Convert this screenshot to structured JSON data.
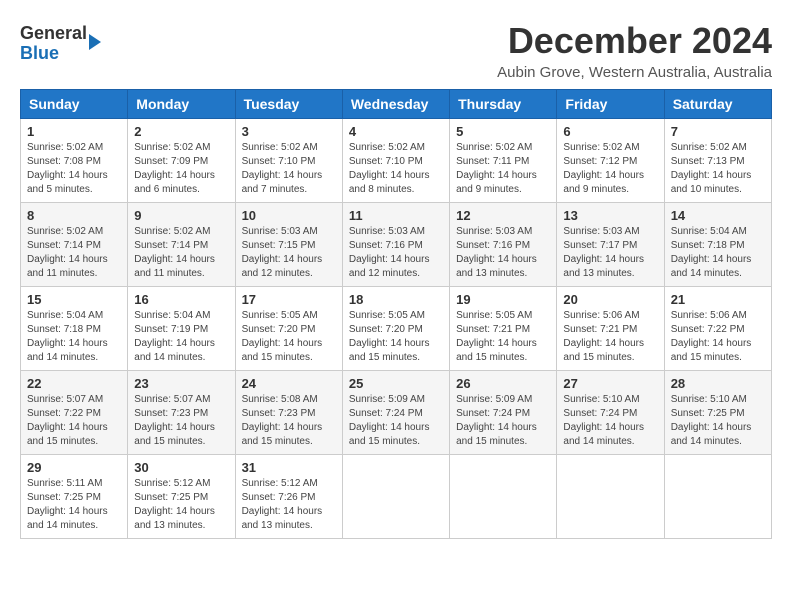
{
  "header": {
    "logo_general": "General",
    "logo_blue": "Blue",
    "title": "December 2024",
    "location": "Aubin Grove, Western Australia, Australia"
  },
  "calendar": {
    "days_of_week": [
      "Sunday",
      "Monday",
      "Tuesday",
      "Wednesday",
      "Thursday",
      "Friday",
      "Saturday"
    ],
    "weeks": [
      [
        {
          "day": "1",
          "info": "Sunrise: 5:02 AM\nSunset: 7:08 PM\nDaylight: 14 hours\nand 5 minutes."
        },
        {
          "day": "2",
          "info": "Sunrise: 5:02 AM\nSunset: 7:09 PM\nDaylight: 14 hours\nand 6 minutes."
        },
        {
          "day": "3",
          "info": "Sunrise: 5:02 AM\nSunset: 7:10 PM\nDaylight: 14 hours\nand 7 minutes."
        },
        {
          "day": "4",
          "info": "Sunrise: 5:02 AM\nSunset: 7:10 PM\nDaylight: 14 hours\nand 8 minutes."
        },
        {
          "day": "5",
          "info": "Sunrise: 5:02 AM\nSunset: 7:11 PM\nDaylight: 14 hours\nand 9 minutes."
        },
        {
          "day": "6",
          "info": "Sunrise: 5:02 AM\nSunset: 7:12 PM\nDaylight: 14 hours\nand 9 minutes."
        },
        {
          "day": "7",
          "info": "Sunrise: 5:02 AM\nSunset: 7:13 PM\nDaylight: 14 hours\nand 10 minutes."
        }
      ],
      [
        {
          "day": "8",
          "info": "Sunrise: 5:02 AM\nSunset: 7:14 PM\nDaylight: 14 hours\nand 11 minutes."
        },
        {
          "day": "9",
          "info": "Sunrise: 5:02 AM\nSunset: 7:14 PM\nDaylight: 14 hours\nand 11 minutes."
        },
        {
          "day": "10",
          "info": "Sunrise: 5:03 AM\nSunset: 7:15 PM\nDaylight: 14 hours\nand 12 minutes."
        },
        {
          "day": "11",
          "info": "Sunrise: 5:03 AM\nSunset: 7:16 PM\nDaylight: 14 hours\nand 12 minutes."
        },
        {
          "day": "12",
          "info": "Sunrise: 5:03 AM\nSunset: 7:16 PM\nDaylight: 14 hours\nand 13 minutes."
        },
        {
          "day": "13",
          "info": "Sunrise: 5:03 AM\nSunset: 7:17 PM\nDaylight: 14 hours\nand 13 minutes."
        },
        {
          "day": "14",
          "info": "Sunrise: 5:04 AM\nSunset: 7:18 PM\nDaylight: 14 hours\nand 14 minutes."
        }
      ],
      [
        {
          "day": "15",
          "info": "Sunrise: 5:04 AM\nSunset: 7:18 PM\nDaylight: 14 hours\nand 14 minutes."
        },
        {
          "day": "16",
          "info": "Sunrise: 5:04 AM\nSunset: 7:19 PM\nDaylight: 14 hours\nand 14 minutes."
        },
        {
          "day": "17",
          "info": "Sunrise: 5:05 AM\nSunset: 7:20 PM\nDaylight: 14 hours\nand 15 minutes."
        },
        {
          "day": "18",
          "info": "Sunrise: 5:05 AM\nSunset: 7:20 PM\nDaylight: 14 hours\nand 15 minutes."
        },
        {
          "day": "19",
          "info": "Sunrise: 5:05 AM\nSunset: 7:21 PM\nDaylight: 14 hours\nand 15 minutes."
        },
        {
          "day": "20",
          "info": "Sunrise: 5:06 AM\nSunset: 7:21 PM\nDaylight: 14 hours\nand 15 minutes."
        },
        {
          "day": "21",
          "info": "Sunrise: 5:06 AM\nSunset: 7:22 PM\nDaylight: 14 hours\nand 15 minutes."
        }
      ],
      [
        {
          "day": "22",
          "info": "Sunrise: 5:07 AM\nSunset: 7:22 PM\nDaylight: 14 hours\nand 15 minutes."
        },
        {
          "day": "23",
          "info": "Sunrise: 5:07 AM\nSunset: 7:23 PM\nDaylight: 14 hours\nand 15 minutes."
        },
        {
          "day": "24",
          "info": "Sunrise: 5:08 AM\nSunset: 7:23 PM\nDaylight: 14 hours\nand 15 minutes."
        },
        {
          "day": "25",
          "info": "Sunrise: 5:09 AM\nSunset: 7:24 PM\nDaylight: 14 hours\nand 15 minutes."
        },
        {
          "day": "26",
          "info": "Sunrise: 5:09 AM\nSunset: 7:24 PM\nDaylight: 14 hours\nand 15 minutes."
        },
        {
          "day": "27",
          "info": "Sunrise: 5:10 AM\nSunset: 7:24 PM\nDaylight: 14 hours\nand 14 minutes."
        },
        {
          "day": "28",
          "info": "Sunrise: 5:10 AM\nSunset: 7:25 PM\nDaylight: 14 hours\nand 14 minutes."
        }
      ],
      [
        {
          "day": "29",
          "info": "Sunrise: 5:11 AM\nSunset: 7:25 PM\nDaylight: 14 hours\nand 14 minutes."
        },
        {
          "day": "30",
          "info": "Sunrise: 5:12 AM\nSunset: 7:25 PM\nDaylight: 14 hours\nand 13 minutes."
        },
        {
          "day": "31",
          "info": "Sunrise: 5:12 AM\nSunset: 7:26 PM\nDaylight: 14 hours\nand 13 minutes."
        },
        {
          "day": "",
          "info": ""
        },
        {
          "day": "",
          "info": ""
        },
        {
          "day": "",
          "info": ""
        },
        {
          "day": "",
          "info": ""
        }
      ]
    ]
  }
}
